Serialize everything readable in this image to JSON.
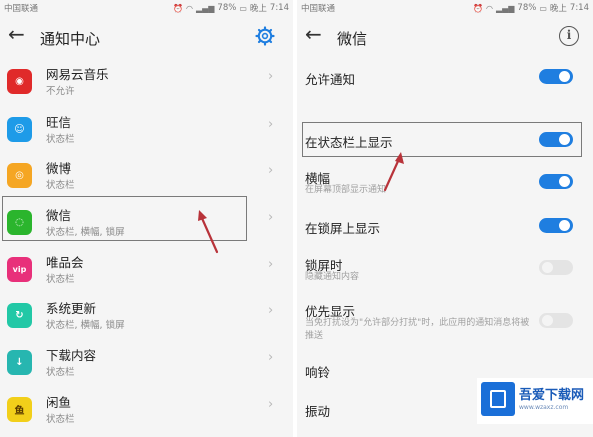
{
  "left_screen": {
    "status_bar": {
      "carrier": "中国联通",
      "battery": "78%",
      "time_prefix": "晚上",
      "time": "7:14"
    },
    "title": "通知中心",
    "apps": [
      {
        "name": "网易云音乐",
        "sub": "不允许",
        "icon_color": "#e02a2a",
        "icon_glyph": "◉"
      },
      {
        "name": "旺信",
        "sub": "状态栏",
        "icon_color": "#1e9be8",
        "icon_glyph": "☺"
      },
      {
        "name": "微博",
        "sub": "状态栏",
        "icon_color": "#f5a623",
        "icon_glyph": "◎"
      },
      {
        "name": "微信",
        "sub": "状态栏, 横幅, 锁屏",
        "icon_color": "#2bb52d",
        "icon_glyph": "◌"
      },
      {
        "name": "唯品会",
        "sub": "状态栏",
        "icon_color": "#e8307a",
        "icon_glyph": "vip"
      },
      {
        "name": "系统更新",
        "sub": "状态栏, 横幅, 锁屏",
        "icon_color": "#22c8a6",
        "icon_glyph": "↻"
      },
      {
        "name": "下载内容",
        "sub": "状态栏",
        "icon_color": "#27b6b0",
        "icon_glyph": "↓"
      },
      {
        "name": "闲鱼",
        "sub": "状态栏",
        "icon_color": "#f2cf1a",
        "icon_glyph": "鱼"
      }
    ]
  },
  "right_screen": {
    "status_bar": {
      "carrier": "中国联通",
      "battery": "78%",
      "time_prefix": "晚上",
      "time": "7:14"
    },
    "title": "微信",
    "settings": [
      {
        "title": "允许通知",
        "sub": "",
        "toggle": "on"
      },
      {
        "title": "在状态栏上显示",
        "sub": "",
        "toggle": "on"
      },
      {
        "title": "横幅",
        "sub": "在屏幕顶部显示通知",
        "toggle": "on"
      },
      {
        "title": "在锁屏上显示",
        "sub": "",
        "toggle": "on"
      },
      {
        "title": "锁屏时",
        "sub": "隐藏通知内容",
        "toggle": "off"
      },
      {
        "title": "优先显示",
        "sub": "当免打扰设为\"允许部分打扰\"时，此应用的通知消息将被推送",
        "toggle": "off"
      },
      {
        "title": "响铃",
        "sub": "",
        "toggle": ""
      },
      {
        "title": "振动",
        "sub": "",
        "toggle": ""
      }
    ]
  },
  "watermark": {
    "brand": "吾爱下载网",
    "url": "www.wzaxz.com"
  },
  "colors": {
    "accent": "#1f7ee0",
    "background": "#f5f5f5"
  }
}
